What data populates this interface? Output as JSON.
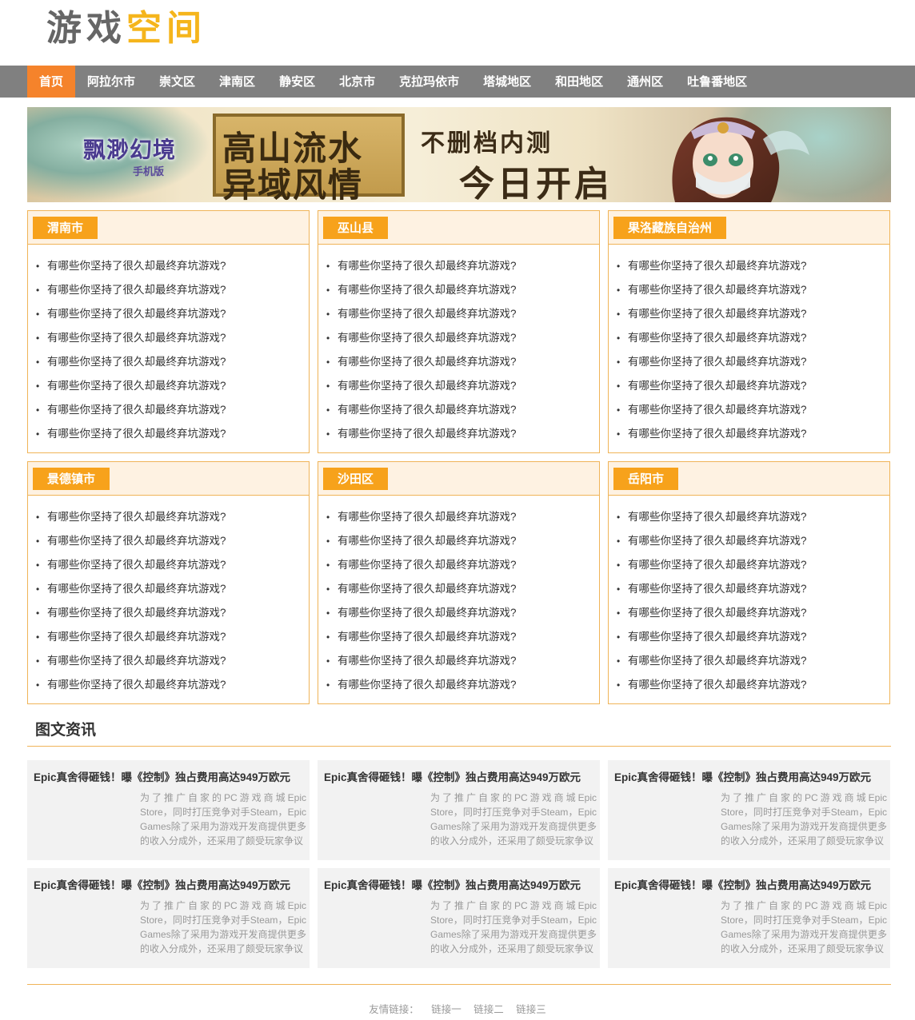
{
  "logo": {
    "part1": "游戏",
    "part2": "空间"
  },
  "nav": {
    "items": [
      "首页",
      "阿拉尔市",
      "崇文区",
      "津南区",
      "静安区",
      "北京市",
      "克拉玛依市",
      "塔城地区",
      "和田地区",
      "通州区",
      "吐鲁番地区"
    ],
    "active_index": 0
  },
  "banner": {
    "game_logo": "飘渺幻境",
    "game_logo_sub": "手机版",
    "slogan_line1": "高山流水",
    "slogan_line2": "异域风情",
    "tag_line1": "不删档内测",
    "tag_line2": "今日开启"
  },
  "regions": [
    {
      "title": "渭南市",
      "items": [
        "有哪些你坚持了很久却最终弃坑游戏?",
        "有哪些你坚持了很久却最终弃坑游戏?",
        "有哪些你坚持了很久却最终弃坑游戏?",
        "有哪些你坚持了很久却最终弃坑游戏?",
        "有哪些你坚持了很久却最终弃坑游戏?",
        "有哪些你坚持了很久却最终弃坑游戏?",
        "有哪些你坚持了很久却最终弃坑游戏?",
        "有哪些你坚持了很久却最终弃坑游戏?"
      ]
    },
    {
      "title": "巫山县",
      "items": [
        "有哪些你坚持了很久却最终弃坑游戏?",
        "有哪些你坚持了很久却最终弃坑游戏?",
        "有哪些你坚持了很久却最终弃坑游戏?",
        "有哪些你坚持了很久却最终弃坑游戏?",
        "有哪些你坚持了很久却最终弃坑游戏?",
        "有哪些你坚持了很久却最终弃坑游戏?",
        "有哪些你坚持了很久却最终弃坑游戏?",
        "有哪些你坚持了很久却最终弃坑游戏?"
      ]
    },
    {
      "title": "果洛藏族自治州",
      "items": [
        "有哪些你坚持了很久却最终弃坑游戏?",
        "有哪些你坚持了很久却最终弃坑游戏?",
        "有哪些你坚持了很久却最终弃坑游戏?",
        "有哪些你坚持了很久却最终弃坑游戏?",
        "有哪些你坚持了很久却最终弃坑游戏?",
        "有哪些你坚持了很久却最终弃坑游戏?",
        "有哪些你坚持了很久却最终弃坑游戏?",
        "有哪些你坚持了很久却最终弃坑游戏?"
      ]
    },
    {
      "title": "景德镇市",
      "items": [
        "有哪些你坚持了很久却最终弃坑游戏?",
        "有哪些你坚持了很久却最终弃坑游戏?",
        "有哪些你坚持了很久却最终弃坑游戏?",
        "有哪些你坚持了很久却最终弃坑游戏?",
        "有哪些你坚持了很久却最终弃坑游戏?",
        "有哪些你坚持了很久却最终弃坑游戏?",
        "有哪些你坚持了很久却最终弃坑游戏?",
        "有哪些你坚持了很久却最终弃坑游戏?"
      ]
    },
    {
      "title": "沙田区",
      "items": [
        "有哪些你坚持了很久却最终弃坑游戏?",
        "有哪些你坚持了很久却最终弃坑游戏?",
        "有哪些你坚持了很久却最终弃坑游戏?",
        "有哪些你坚持了很久却最终弃坑游戏?",
        "有哪些你坚持了很久却最终弃坑游戏?",
        "有哪些你坚持了很久却最终弃坑游戏?",
        "有哪些你坚持了很久却最终弃坑游戏?",
        "有哪些你坚持了很久却最终弃坑游戏?"
      ]
    },
    {
      "title": "岳阳市",
      "items": [
        "有哪些你坚持了很久却最终弃坑游戏?",
        "有哪些你坚持了很久却最终弃坑游戏?",
        "有哪些你坚持了很久却最终弃坑游戏?",
        "有哪些你坚持了很久却最终弃坑游戏?",
        "有哪些你坚持了很久却最终弃坑游戏?",
        "有哪些你坚持了很久却最终弃坑游戏?",
        "有哪些你坚持了很久却最终弃坑游戏?",
        "有哪些你坚持了很久却最终弃坑游戏?"
      ]
    }
  ],
  "news_section": {
    "title": "图文资讯",
    "cards": [
      {
        "title": "Epic真舍得砸钱！曝《控制》独占费用高达949万欧元",
        "desc": "为了推广自家的PC游戏商城Epic Store，同时打压竞争对手Steam，Epic Games除了采用为游戏开发商提供更多的收入分成外，还采用了颇受玩家争议"
      },
      {
        "title": "Epic真舍得砸钱！曝《控制》独占费用高达949万欧元",
        "desc": "为了推广自家的PC游戏商城Epic Store，同时打压竞争对手Steam，Epic Games除了采用为游戏开发商提供更多的收入分成外，还采用了颇受玩家争议"
      },
      {
        "title": "Epic真舍得砸钱！曝《控制》独占费用高达949万欧元",
        "desc": "为了推广自家的PC游戏商城Epic Store，同时打压竞争对手Steam，Epic Games除了采用为游戏开发商提供更多的收入分成外，还采用了颇受玩家争议"
      },
      {
        "title": "Epic真舍得砸钱！曝《控制》独占费用高达949万欧元",
        "desc": "为了推广自家的PC游戏商城Epic Store，同时打压竞争对手Steam，Epic Games除了采用为游戏开发商提供更多的收入分成外，还采用了颇受玩家争议"
      },
      {
        "title": "Epic真舍得砸钱！曝《控制》独占费用高达949万欧元",
        "desc": "为了推广自家的PC游戏商城Epic Store，同时打压竞争对手Steam，Epic Games除了采用为游戏开发商提供更多的收入分成外，还采用了颇受玩家争议"
      },
      {
        "title": "Epic真舍得砸钱！曝《控制》独占费用高达949万欧元",
        "desc": "为了推广自家的PC游戏商城Epic Store，同时打压竞争对手Steam，Epic Games除了采用为游戏开发商提供更多的收入分成外，还采用了颇受玩家争议"
      }
    ]
  },
  "footer": {
    "label": "友情链接：",
    "links": [
      "链接一",
      "链接二",
      "链接三"
    ]
  },
  "colors": {
    "accent_orange": "#f7a21b",
    "nav_active": "#f5832b",
    "nav_bg": "#808080",
    "logo_gray": "#666666",
    "logo_yellow": "#f5b51c",
    "box_border": "#f0b458",
    "box_header_bg": "#fef2e2"
  }
}
